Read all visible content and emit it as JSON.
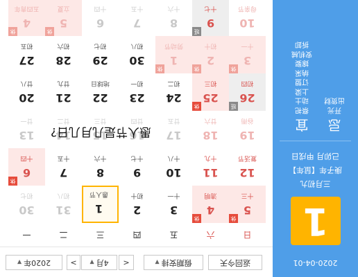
{
  "left_panel": {
    "date": "2020-04-01",
    "day_number": "1",
    "lunar_lines": [
      "三月初九",
      "庚子年【鼠年】",
      "己卯月 甲戌日"
    ],
    "yi_label": "宜",
    "ji_label": "忌",
    "yi_items": [
      "祭祀",
      "动土",
      "上梁",
      "订盟",
      "纳采",
      "嫁娶",
      "安机械",
      "拆卸"
    ],
    "ji_items": [
      "开光",
      "出货财"
    ]
  },
  "toolbar": {
    "year": "2020年",
    "month": "4月",
    "prev_month": "<",
    "next_month": ">",
    "holiday": "假期安排",
    "back_today": "返回今天"
  },
  "weekdays": [
    "一",
    "二",
    "三",
    "四",
    "五",
    "六",
    "日"
  ],
  "weeks": [
    [
      {
        "n": "30",
        "s": "初七",
        "dim": true
      },
      {
        "n": "31",
        "s": "初八",
        "dim": true
      },
      {
        "n": "1",
        "s": "愚人节",
        "today": true
      },
      {
        "n": "2",
        "s": "初十"
      },
      {
        "n": "3",
        "s": "十一"
      },
      {
        "n": "4",
        "s": "清明",
        "holiday": true,
        "tag": "休"
      },
      {
        "n": "5",
        "s": "十三",
        "holiday": true,
        "tag": "休"
      }
    ],
    [
      {
        "n": "6",
        "s": "十四",
        "holiday": true,
        "tag": "休"
      },
      {
        "n": "7",
        "s": "十五"
      },
      {
        "n": "8",
        "s": "十六"
      },
      {
        "n": "9",
        "s": "十七"
      },
      {
        "n": "10",
        "s": "十八"
      },
      {
        "n": "11",
        "s": "十九"
      },
      {
        "n": "12",
        "s": "复活节"
      }
    ],
    [
      {
        "n": "13",
        "s": "廿一",
        "dim": true
      },
      {
        "n": "14",
        "s": "廿二",
        "dim": true
      },
      {
        "n": "15",
        "s": "廿三",
        "dim": true
      },
      {
        "n": "16",
        "s": "廿四",
        "dim": true
      },
      {
        "n": "17",
        "s": "廿五",
        "dim": true
      },
      {
        "n": "18",
        "s": "廿六",
        "dim": true
      },
      {
        "n": "19",
        "s": "谷雨",
        "dim": true
      }
    ],
    [
      {
        "n": "20",
        "s": "廿八"
      },
      {
        "n": "21",
        "s": "廿九"
      },
      {
        "n": "22",
        "s": "地球日"
      },
      {
        "n": "23",
        "s": "初一"
      },
      {
        "n": "24",
        "s": "初二"
      },
      {
        "n": "25",
        "s": "初三",
        "holiday": true,
        "tag": "休"
      },
      {
        "n": "26",
        "s": "初四",
        "work": true,
        "tag": "班"
      }
    ],
    [
      {
        "n": "27",
        "s": "初五"
      },
      {
        "n": "28",
        "s": "初六"
      },
      {
        "n": "29",
        "s": "初七"
      },
      {
        "n": "30",
        "s": "初八"
      },
      {
        "n": "1",
        "s": "劳动节",
        "holiday": true,
        "tag": "休",
        "dim": true
      },
      {
        "n": "2",
        "s": "初十",
        "holiday": true,
        "tag": "休",
        "dim": true
      },
      {
        "n": "3",
        "s": "十一",
        "holiday": true,
        "tag": "休",
        "dim": true
      }
    ],
    [
      {
        "n": "4",
        "s": "五四青年",
        "holiday": true,
        "tag": "休",
        "dim": true
      },
      {
        "n": "5",
        "s": "立夏",
        "holiday": true,
        "tag": "休",
        "dim": true
      },
      {
        "n": "6",
        "s": "十四",
        "dim": true
      },
      {
        "n": "7",
        "s": "十五",
        "dim": true
      },
      {
        "n": "8",
        "s": "十六",
        "dim": true
      },
      {
        "n": "9",
        "s": "十七",
        "work": true,
        "tag": "班"
      },
      {
        "n": "10",
        "s": "母亲节",
        "dim": true
      }
    ]
  ],
  "overlay_text": "愚人节是几月几日?"
}
